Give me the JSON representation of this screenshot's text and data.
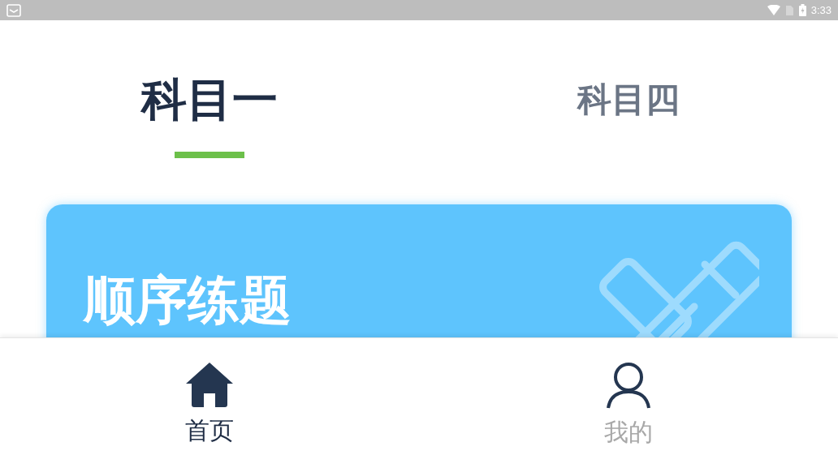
{
  "status_bar": {
    "time": "3:33"
  },
  "tabs": [
    {
      "label": "科目一",
      "selected": true
    },
    {
      "label": "科目四",
      "selected": false
    }
  ],
  "card": {
    "title": "顺序练题"
  },
  "bottom_nav": [
    {
      "label": "首页",
      "kind": "home",
      "selected": true
    },
    {
      "label": "我的",
      "kind": "profile",
      "selected": false
    }
  ]
}
